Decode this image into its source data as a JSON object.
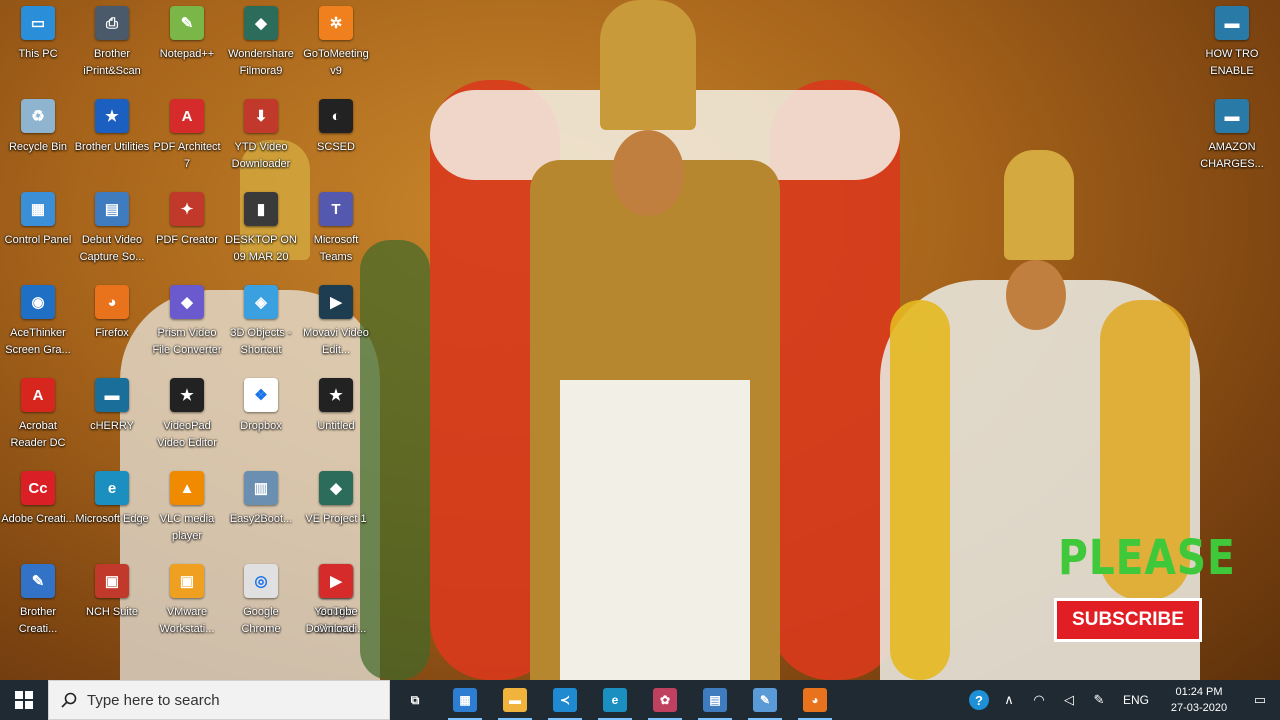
{
  "desktop": {
    "icons": [
      {
        "label": "This PC",
        "icon": "this-pc-icon",
        "color": "#2a8fd8",
        "glyph": "▭"
      },
      {
        "label": "Recycle Bin",
        "icon": "recycle-bin-icon",
        "color": "#8fb4d0",
        "glyph": "♻"
      },
      {
        "label": "Control Panel",
        "icon": "control-panel-icon",
        "color": "#3b8fd6",
        "glyph": "▦"
      },
      {
        "label": "AceThinker Screen Gra...",
        "icon": "acethinker-icon",
        "color": "#1f6fc5",
        "glyph": "◉"
      },
      {
        "label": "Acrobat Reader DC",
        "icon": "acrobat-icon",
        "color": "#d7261e",
        "glyph": "A"
      },
      {
        "label": "Adobe Creati...",
        "icon": "adobe-creative-icon",
        "color": "#da1f26",
        "glyph": "Cc"
      },
      {
        "label": "Brother Creati...",
        "icon": "brother-creative-icon",
        "color": "#3273c8",
        "glyph": "✎"
      },
      {
        "label": "Brother iPrint&Scan",
        "icon": "brother-iprint-icon",
        "color": "#4a5a6a",
        "glyph": "⎙"
      },
      {
        "label": "Brother Utilities",
        "icon": "brother-utilities-icon",
        "color": "#1b5fc0",
        "glyph": "★"
      },
      {
        "label": "Debut Video Capture So...",
        "icon": "debut-video-icon",
        "color": "#3e7bbf",
        "glyph": "▤"
      },
      {
        "label": "Firefox",
        "icon": "firefox-icon",
        "color": "#e8731c",
        "glyph": "◕"
      },
      {
        "label": "cHERRY",
        "icon": "cherry-icon",
        "color": "#1a6f9a",
        "glyph": "▬"
      },
      {
        "label": "Microsoft Edge",
        "icon": "edge-icon",
        "color": "#1a8fc0",
        "glyph": "e"
      },
      {
        "label": "NCH Suite",
        "icon": "nch-suite-icon",
        "color": "#c0392b",
        "glyph": "▣"
      },
      {
        "label": "Notepad++",
        "icon": "notepad-plus-icon",
        "color": "#7ab648",
        "glyph": "✎"
      },
      {
        "label": "PDF Architect 7",
        "icon": "pdf-architect-icon",
        "color": "#d62b2b",
        "glyph": "A"
      },
      {
        "label": "PDF Creator",
        "icon": "pdf-creator-icon",
        "color": "#c0392b",
        "glyph": "✦"
      },
      {
        "label": "Prism Video File Converter",
        "icon": "prism-icon",
        "color": "#6a5acd",
        "glyph": "◆"
      },
      {
        "label": "VideoPad Video Editor",
        "icon": "videopad-icon",
        "color": "#222222",
        "glyph": "★"
      },
      {
        "label": "VLC media player",
        "icon": "vlc-icon",
        "color": "#f08a00",
        "glyph": "▲"
      },
      {
        "label": "VMware Workstati...",
        "icon": "vmware-icon",
        "color": "#f0a020",
        "glyph": "▣"
      },
      {
        "label": "Wondershare Filmora9",
        "icon": "filmora-icon",
        "color": "#2b6d5a",
        "glyph": "◆"
      },
      {
        "label": "YTD Video Downloader",
        "icon": "ytd-icon",
        "color": "#c0392b",
        "glyph": "⬇"
      },
      {
        "label": "DESKTOP ON 09 MAR 20",
        "icon": "folder-icon",
        "color": "#3a3a3a",
        "glyph": "▮"
      },
      {
        "label": "3D Objects - Shortcut",
        "icon": "3d-objects-icon",
        "color": "#3aa0e0",
        "glyph": "◈"
      },
      {
        "label": "Dropbox",
        "icon": "dropbox-icon",
        "color": "#ffffff",
        "glyph": "❖"
      },
      {
        "label": "Easy2Boot...",
        "icon": "easy2boot-icon",
        "color": "#6b8fb0",
        "glyph": "▥"
      },
      {
        "label": "Google Chrome",
        "icon": "chrome-icon",
        "color": "#e0e0e0",
        "glyph": "◎"
      },
      {
        "label": "GoToMeeting v9",
        "icon": "gotomeeting-icon",
        "color": "#f07f1d",
        "glyph": "✲"
      },
      {
        "label": "SCSED",
        "icon": "scsed-icon",
        "color": "#222222",
        "glyph": "◐"
      },
      {
        "label": "Microsoft Teams",
        "icon": "teams-icon",
        "color": "#5558af",
        "glyph": "T"
      },
      {
        "label": "Movavi Video Edit...",
        "icon": "movavi-icon",
        "color": "#1e3d50",
        "glyph": "▶"
      },
      {
        "label": "Untitled",
        "icon": "untitled-icon",
        "color": "#222222",
        "glyph": "★"
      },
      {
        "label": "VE Project 1",
        "icon": "ve-project-icon",
        "color": "#2b6d5a",
        "glyph": "◆"
      },
      {
        "label": "Google Chrome",
        "icon": "chrome-icon",
        "color": "#e0e0e0",
        "glyph": "◎"
      },
      {
        "label": "YouTube Downloadi...",
        "icon": "youtube-downloader-icon",
        "color": "#d62b2b",
        "glyph": "▶"
      },
      {
        "label": "HOW TRO ENABLE",
        "icon": "how-tro-enable-icon",
        "color": "#2a7aa8",
        "glyph": "▬"
      },
      {
        "label": "AMAZON CHARGES...",
        "icon": "amazon-charges-icon",
        "color": "#2a7aa8",
        "glyph": "▬"
      }
    ]
  },
  "overlay": {
    "please_text": "PLEASE",
    "subscribe_label": "SUBSCRIBE"
  },
  "taskbar": {
    "search_placeholder": "Type here to search",
    "apps": [
      {
        "name": "task-view-icon",
        "glyph": "⧉",
        "color": "transparent"
      },
      {
        "name": "store-icon",
        "glyph": "▦",
        "color": "#2d7dd2"
      },
      {
        "name": "file-explorer-icon",
        "glyph": "▬",
        "color": "#f0b43c"
      },
      {
        "name": "vscode-icon",
        "glyph": "≺",
        "color": "#1f8ad2"
      },
      {
        "name": "edge-icon",
        "glyph": "e",
        "color": "#1a8fc0"
      },
      {
        "name": "paint-icon",
        "glyph": "✿",
        "color": "#c04060"
      },
      {
        "name": "video-capture-icon",
        "glyph": "▤",
        "color": "#3e7bbf"
      },
      {
        "name": "paint3d-icon",
        "glyph": "✎",
        "color": "#5a9ad6"
      },
      {
        "name": "firefox-icon",
        "glyph": "◕",
        "color": "#e8731c"
      }
    ],
    "tray": {
      "language": "ENG",
      "time": "01:24 PM",
      "date": "27-03-2020"
    }
  }
}
